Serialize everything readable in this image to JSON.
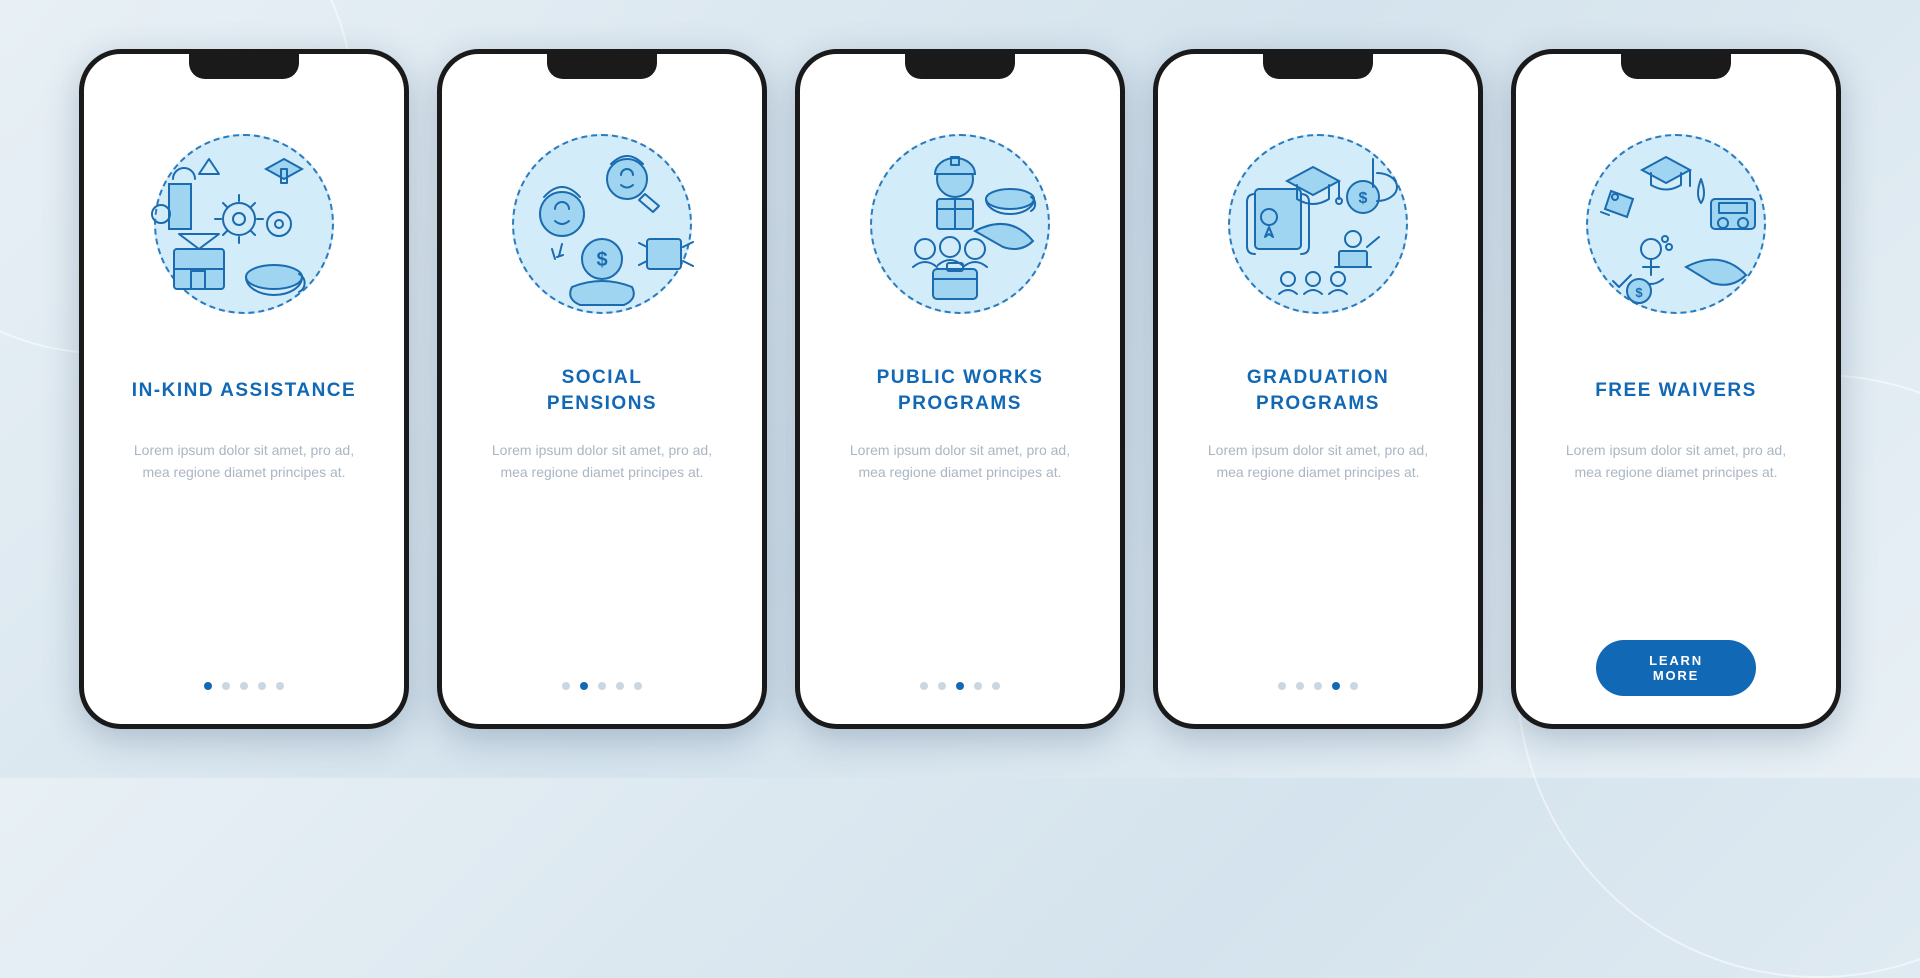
{
  "colors": {
    "primary": "#1168b5",
    "icon_stroke": "#1a6bb0",
    "icon_fill": "#9fd5f0",
    "dot_inactive": "#c7d7e4",
    "text_muted": "#aab6c2"
  },
  "slides": [
    {
      "title": "IN-KIND ASSISTANCE",
      "description": "Lorem ipsum dolor sit amet, pro ad, mea regione diamet principes at.",
      "icon_name": "in-kind-assistance-icon",
      "active_dot": 0,
      "has_cta": false
    },
    {
      "title": "SOCIAL\nPENSIONS",
      "description": "Lorem ipsum dolor sit amet, pro ad, mea regione diamet principes at.",
      "icon_name": "social-pensions-icon",
      "active_dot": 1,
      "has_cta": false
    },
    {
      "title": "PUBLIC WORKS\nPROGRAMS",
      "description": "Lorem ipsum dolor sit amet, pro ad, mea regione diamet principes at.",
      "icon_name": "public-works-icon",
      "active_dot": 2,
      "has_cta": false
    },
    {
      "title": "GRADUATION\nPROGRAMS",
      "description": "Lorem ipsum dolor sit amet, pro ad, mea regione diamet principes at.",
      "icon_name": "graduation-programs-icon",
      "active_dot": 3,
      "has_cta": false
    },
    {
      "title": "FREE WAIVERS",
      "description": "Lorem ipsum dolor sit amet, pro ad, mea regione diamet principes at.",
      "icon_name": "free-waivers-icon",
      "active_dot": 4,
      "has_cta": true
    }
  ],
  "cta_label": "LEARN MORE",
  "dot_count": 5
}
